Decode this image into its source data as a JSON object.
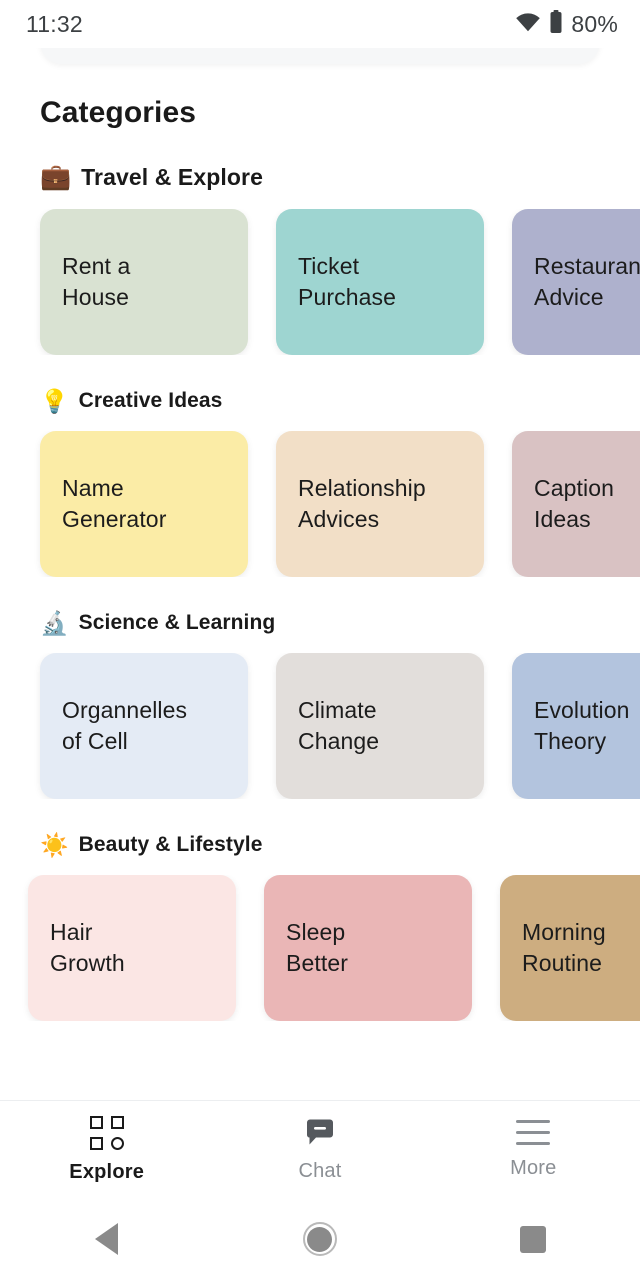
{
  "status_bar": {
    "time": "11:32",
    "battery_percent": "80%",
    "wifi_icon": "wifi-icon",
    "battery_icon": "battery-icon"
  },
  "page": {
    "title": "Categories"
  },
  "colors": {
    "text_primary": "#1a1a1a",
    "text_muted": "#8b8f94",
    "background": "#ffffff"
  },
  "sections": [
    {
      "emoji": "💼",
      "emoji_name": "briefcase-icon",
      "label": "Travel & Explore",
      "cards": [
        {
          "label": "Rent a\nHouse",
          "color": "#d9e2d2"
        },
        {
          "label": "Ticket\nPurchase",
          "color": "#9ed5d1"
        },
        {
          "label": "Restaurant\nAdvice",
          "color": "#aeb1cd"
        }
      ]
    },
    {
      "emoji": "💡",
      "emoji_name": "lightbulb-icon",
      "label": "Creative Ideas",
      "cards": [
        {
          "label": "Name\nGenerator",
          "color": "#fbeca6"
        },
        {
          "label": "Relationship\nAdvices",
          "color": "#f2dfc7"
        },
        {
          "label": "Caption\nIdeas",
          "color": "#d9c2c3"
        }
      ]
    },
    {
      "emoji": "🔬",
      "emoji_name": "microscope-icon",
      "label": "Science & Learning",
      "cards": [
        {
          "label": "Organnelles\nof Cell",
          "color": "#e4ebf5"
        },
        {
          "label": "Climate\nChange",
          "color": "#e2dedb"
        },
        {
          "label": "Evolution\nTheory",
          "color": "#b3c4de"
        }
      ]
    },
    {
      "emoji": "☀️",
      "emoji_name": "sun-icon",
      "label": "Beauty & Lifestyle",
      "cards": [
        {
          "label": "Hair\nGrowth",
          "color": "#fbe6e4"
        },
        {
          "label": "Sleep\nBetter",
          "color": "#eab6b6"
        },
        {
          "label": "Morning\nRoutine",
          "color": "#cdad80"
        }
      ]
    }
  ],
  "tab_bar": {
    "tabs": [
      {
        "label": "Explore",
        "icon": "grid-icon",
        "active": true
      },
      {
        "label": "Chat",
        "icon": "chat-bubble-icon",
        "active": false
      },
      {
        "label": "More",
        "icon": "hamburger-menu-icon",
        "active": false
      }
    ]
  },
  "system_nav": {
    "back": "back-button",
    "home": "home-button",
    "recents": "recents-button"
  }
}
